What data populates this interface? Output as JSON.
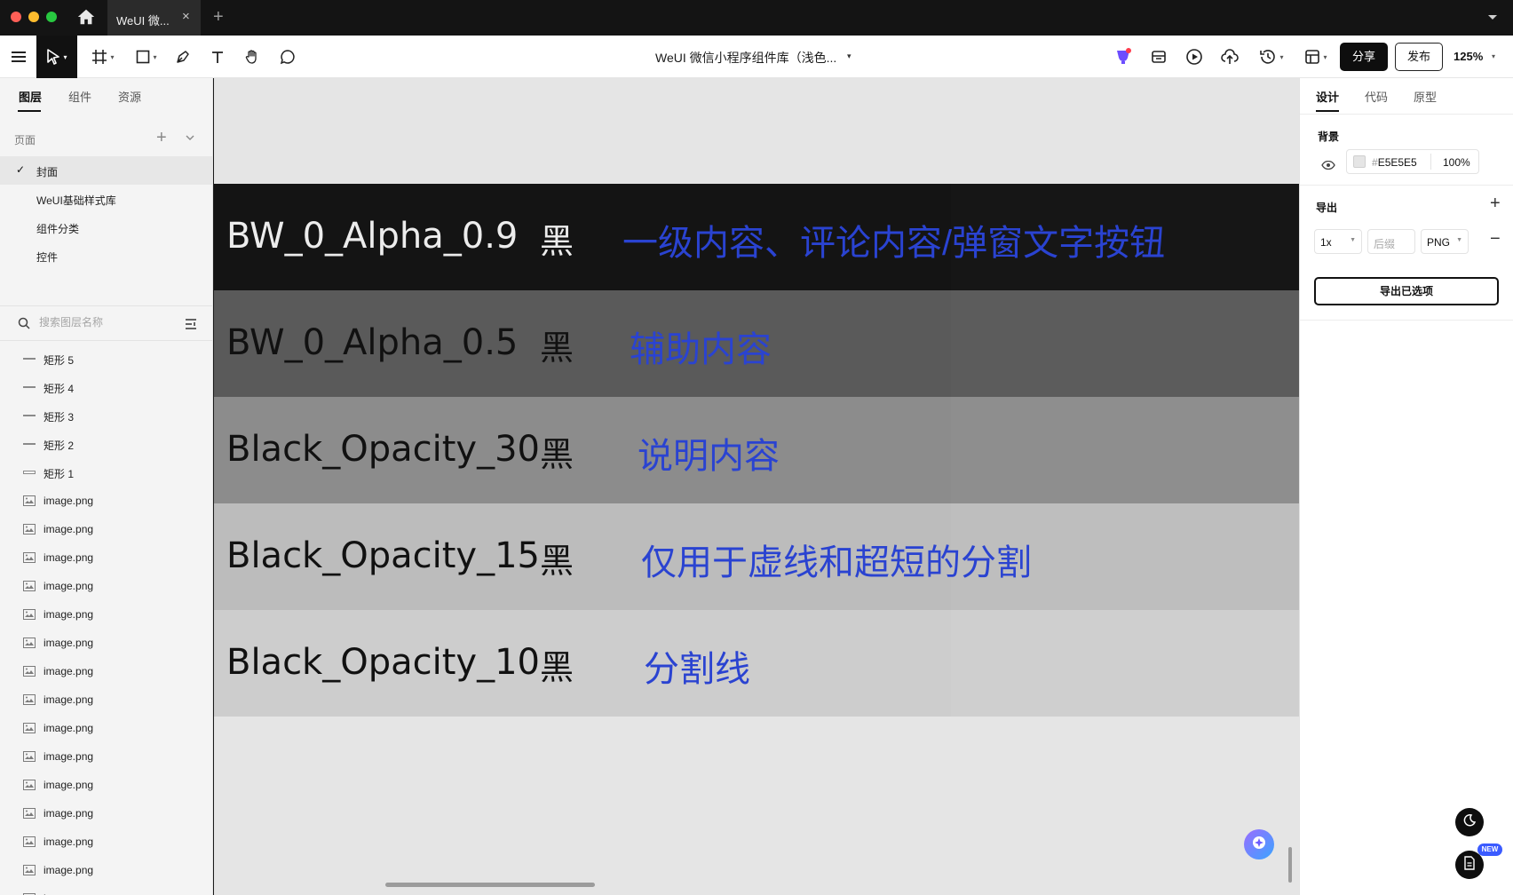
{
  "window": {
    "tab_title": "WeUI 微...",
    "close_glyph": "×",
    "new_tab_glyph": "+"
  },
  "toolbar": {
    "doc_title": "WeUI 微信小程序组件库（浅色...",
    "share_label": "分享",
    "publish_label": "发布",
    "zoom": "125%",
    "tools": [
      "menu-icon",
      "move-tool-icon",
      "frame-tool-icon",
      "shape-tool-icon",
      "pen-tool-icon",
      "text-tool-icon",
      "hand-tool-icon",
      "comment-tool-icon"
    ],
    "right_icons": [
      "ai-badge-icon",
      "assets-icon",
      "play-icon",
      "upload-icon",
      "history-icon",
      "layout-icon"
    ]
  },
  "left_panel": {
    "tabs": [
      {
        "label": "图层",
        "active": true
      },
      {
        "label": "组件",
        "active": false
      },
      {
        "label": "资源",
        "active": false
      }
    ],
    "pages_label": "页面",
    "pages": [
      {
        "label": "封面",
        "active": true
      },
      {
        "label": "WeUI基础样式库",
        "active": false
      },
      {
        "label": "组件分类",
        "active": false
      },
      {
        "label": "控件",
        "active": false
      }
    ],
    "search_placeholder": "搜索图层名称",
    "layers": [
      {
        "label": "矩形 5",
        "icon": "line-icon"
      },
      {
        "label": "矩形 4",
        "icon": "line-icon"
      },
      {
        "label": "矩形 3",
        "icon": "line-icon"
      },
      {
        "label": "矩形 2",
        "icon": "line-icon"
      },
      {
        "label": "矩形 1",
        "icon": "rect-icon"
      },
      {
        "label": "image.png",
        "icon": "image-icon"
      },
      {
        "label": "image.png",
        "icon": "image-icon"
      },
      {
        "label": "image.png",
        "icon": "image-icon"
      },
      {
        "label": "image.png",
        "icon": "image-icon"
      },
      {
        "label": "image.png",
        "icon": "image-icon"
      },
      {
        "label": "image.png",
        "icon": "image-icon"
      },
      {
        "label": "image.png",
        "icon": "image-icon"
      },
      {
        "label": "image.png",
        "icon": "image-icon"
      },
      {
        "label": "image.png",
        "icon": "image-icon"
      },
      {
        "label": "image.png",
        "icon": "image-icon"
      },
      {
        "label": "image.png",
        "icon": "image-icon"
      },
      {
        "label": "image.png",
        "icon": "image-icon"
      },
      {
        "label": "image.png",
        "icon": "image-icon"
      },
      {
        "label": "image.png",
        "icon": "image-icon"
      },
      {
        "label": "image.png",
        "icon": "image-icon"
      }
    ]
  },
  "canvas": {
    "swatches": [
      {
        "name": "BW_0_Alpha_0.9",
        "black": "黑",
        "desc": "一级内容、评论内容/弹窗文字按钮",
        "bg_left": "#141414",
        "bg_right": "#161616",
        "text_color": "#ececec"
      },
      {
        "name": "BW_0_Alpha_0.5",
        "black": "黑",
        "desc": "辅助内容",
        "bg_left": "#5a5a5a",
        "bg_right": "#5c5c5c",
        "text_color": "#111111"
      },
      {
        "name": "Black_Opacity_30",
        "black": "黑",
        "desc": "说明内容",
        "bg_left": "#8c8c8c",
        "bg_right": "#8e8e8e",
        "text_color": "#111111"
      },
      {
        "name": "Black_Opacity_15",
        "black": "黑",
        "desc": "仅用于虚线和超短的分割",
        "bg_left": "#bcbcbc",
        "bg_right": "#bebebe",
        "text_color": "#111111"
      },
      {
        "name": "Black_Opacity_10",
        "black": "黑",
        "desc": "分割线",
        "bg_left": "#cdcdcd",
        "bg_right": "#cfcfcf",
        "text_color": "#111111"
      }
    ],
    "desc_color": "#2a43d1"
  },
  "right_panel": {
    "tabs": [
      {
        "label": "设计",
        "active": true
      },
      {
        "label": "代码",
        "active": false
      },
      {
        "label": "原型",
        "active": false
      }
    ],
    "background_title": "背景",
    "bg_hash": "#",
    "bg_hex": "E5E5E5",
    "bg_opacity": "100%",
    "export_title": "导出",
    "export_scale": "1x",
    "export_suffix_placeholder": "后缀",
    "export_format": "PNG",
    "export_button": "导出已选项",
    "new_badge": "NEW"
  }
}
